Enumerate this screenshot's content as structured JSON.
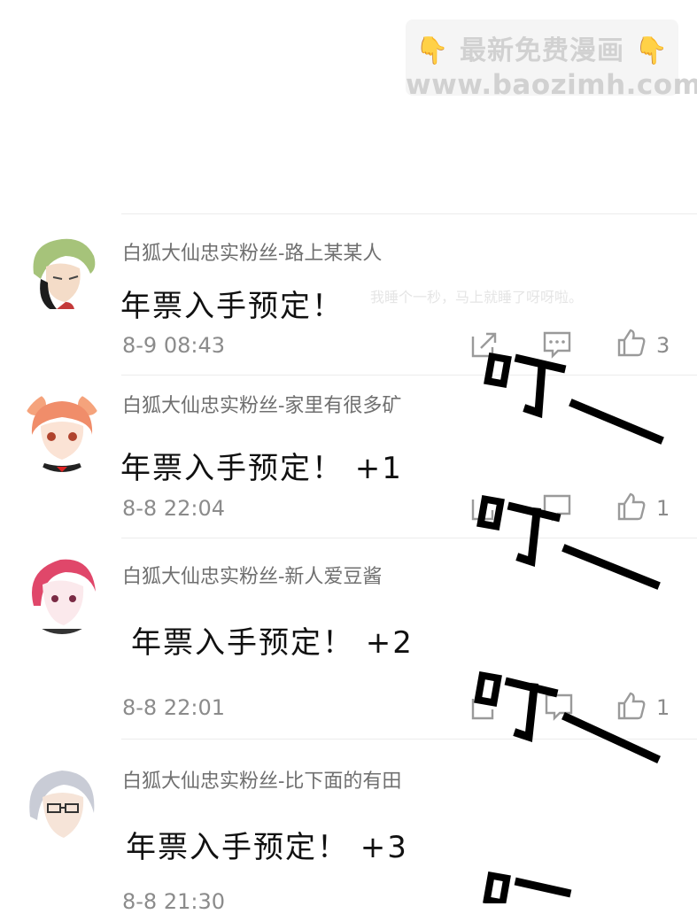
{
  "watermark": {
    "line1": "最新免费漫画",
    "hand_icon": "👇",
    "line2": "www.baozimh.com"
  },
  "comments": [
    {
      "username": "白狐大仙忠实粉丝-路上某某人",
      "content": "年票入手预定！",
      "timestamp": "8-9 08:43",
      "likes": "3",
      "avatar": "green-haired-man-avatar"
    },
    {
      "username": "白狐大仙忠实粉丝-家里有很多矿",
      "content": "年票入手预定！ +1",
      "timestamp": "8-8 22:04",
      "likes": "1",
      "avatar": "orange-bun-haired-girl-avatar"
    },
    {
      "username": "白狐大仙忠实粉丝-新人爱豆酱",
      "content": "年票入手预定！ +2",
      "timestamp": "8-8 22:01",
      "likes": "1",
      "avatar": "pink-haired-man-avatar"
    },
    {
      "username": "白狐大仙忠实粉丝-比下面的有田",
      "content": "年票入手预定！ +3",
      "timestamp": "8-8 21:30",
      "likes": "",
      "avatar": "silver-haired-glasses-man-avatar"
    }
  ],
  "ghost_text": {
    "faded_comment": "我睡个一秒，马上就睡了呀呀啦。"
  },
  "sound_effect": {
    "text": "叮一",
    "repeat": 4
  },
  "colors": {
    "username": "#6f6f6f",
    "timestamp": "#8b8b8b",
    "divider": "#ececec",
    "watermark_hand": "#f2b53a"
  }
}
